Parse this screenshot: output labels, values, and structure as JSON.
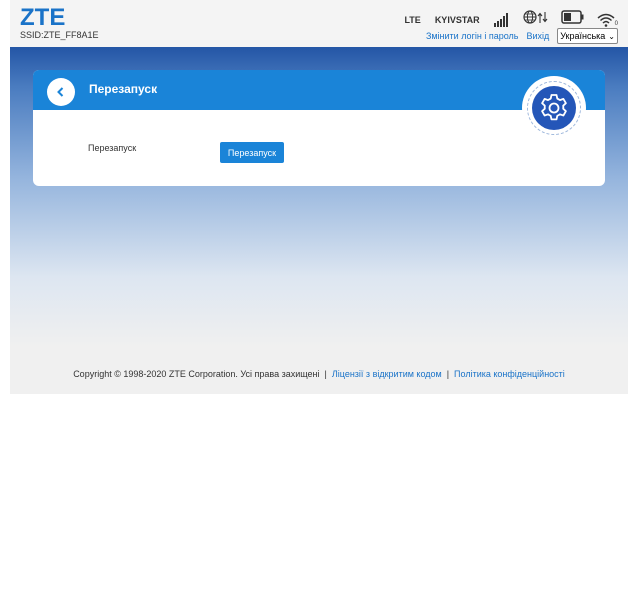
{
  "header": {
    "logo": "ZTE",
    "ssid": "SSID:ZTE_FF8A1E",
    "network_type": "LTE",
    "operator": "KYIVSTAR",
    "wifi_clients": "0",
    "change_login_link": "Змінити логін і пароль",
    "logout_link": "Вихід",
    "language_selected": "Українська"
  },
  "page": {
    "title": "Перезапуск",
    "row_label": "Перезапуск",
    "restart_button": "Перезапуск"
  },
  "footer": {
    "copyright": "Copyright © 1998-2020 ZTE Corporation. Усі права захищені",
    "separator": "|",
    "open_source_link": "Ліцензії з відкритим кодом",
    "privacy_link": "Політика конфіденційності"
  },
  "colors": {
    "brand_blue": "#1a73c8",
    "card_header": "#1a84d8",
    "band_dark": "#2456a6",
    "gear_core": "#2456b8"
  },
  "icons": [
    "signal-icon",
    "globe-icon",
    "data-arrows-icon",
    "battery-icon",
    "wifi-icon",
    "back-icon",
    "gear-icon"
  ]
}
